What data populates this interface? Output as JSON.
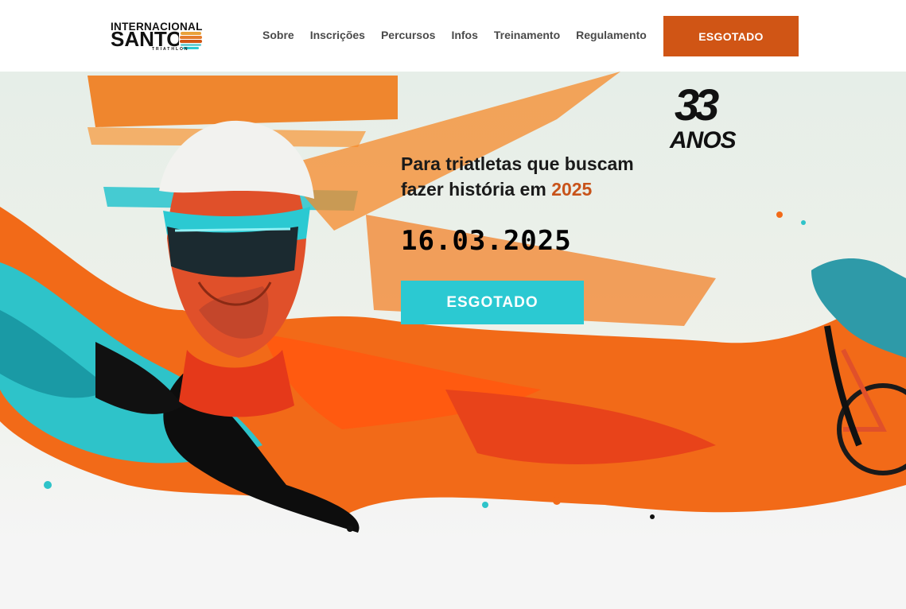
{
  "header": {
    "logo": {
      "line1": "INTERNACIONAL",
      "line2": "SANTOS",
      "line3": "TRIATHLON"
    },
    "nav": [
      {
        "label": "Sobre"
      },
      {
        "label": "Inscrições"
      },
      {
        "label": "Percursos"
      },
      {
        "label": "Infos"
      },
      {
        "label": "Treinamento"
      },
      {
        "label": "Regulamento"
      }
    ],
    "cta_label": "ESGOTADO"
  },
  "hero": {
    "tagline_text": "Para triatletas que buscam fazer história em",
    "tagline_year": "2025",
    "event_date": "16.03.2025",
    "cta_label": "ESGOTADO",
    "badge": {
      "number": "33",
      "word": "ANOS"
    }
  },
  "colors": {
    "brand_orange": "#d05515",
    "accent_cyan": "#2bc9d2",
    "year_highlight": "#c8531a"
  }
}
